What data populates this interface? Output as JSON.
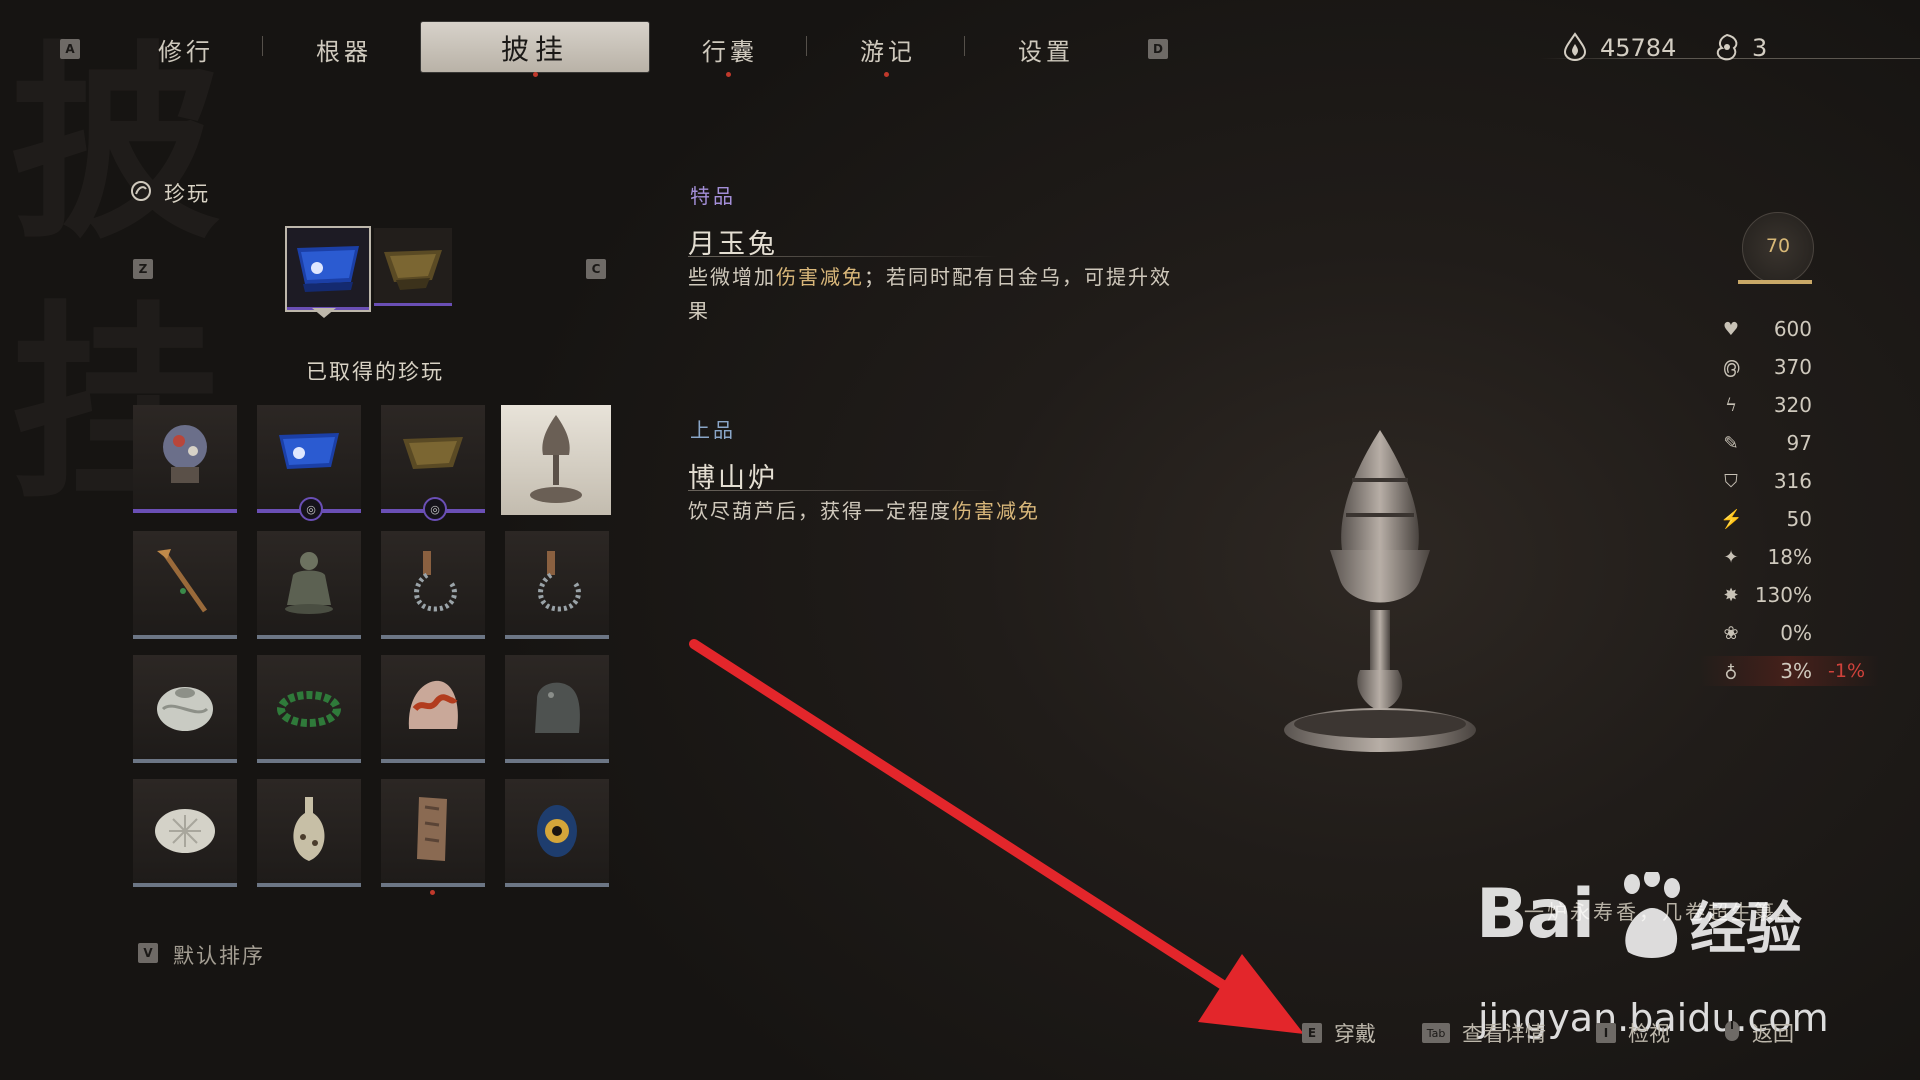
{
  "nav": {
    "left_key": "A",
    "right_key": "D",
    "tabs": [
      {
        "label": "修行"
      },
      {
        "label": "根器"
      },
      {
        "label": "披挂"
      },
      {
        "label": "行囊"
      },
      {
        "label": "游记"
      },
      {
        "label": "设置"
      }
    ]
  },
  "currency": {
    "will_value": "45784",
    "spirit_value": "3"
  },
  "background_chars": [
    "披",
    "挂"
  ],
  "left_panel": {
    "category_label": "珍玩",
    "prev_key": "Z",
    "next_key": "C",
    "acquired_title": "已取得的珍玩",
    "sort_key": "V",
    "sort_label": "默认排序"
  },
  "center": {
    "entries": [
      {
        "tier": "特品",
        "name": "月玉兔",
        "desc_pre": "些微增加",
        "desc_hl": "伤害减免",
        "desc_post": "；若同时配有日金乌，可提升效果"
      },
      {
        "tier": "上品",
        "name": "博山炉",
        "desc_pre": "饮尽葫芦后，获得一定程度",
        "desc_hl": "伤害减免",
        "desc_post": ""
      }
    ]
  },
  "stats": {
    "level": "70",
    "rows": [
      {
        "icon": "heart-icon",
        "value": "600",
        "diff": ""
      },
      {
        "icon": "mana-icon",
        "value": "370",
        "diff": ""
      },
      {
        "icon": "stamina-icon",
        "value": "320",
        "diff": ""
      },
      {
        "icon": "attack-icon",
        "value": "97",
        "diff": ""
      },
      {
        "icon": "defense-icon",
        "value": "316",
        "diff": ""
      },
      {
        "icon": "focus-icon",
        "value": "50",
        "diff": ""
      },
      {
        "icon": "crit-rate-icon",
        "value": "18%",
        "diff": ""
      },
      {
        "icon": "crit-damage-icon",
        "value": "130%",
        "diff": ""
      },
      {
        "icon": "lotus-icon",
        "value": "0%",
        "diff": ""
      },
      {
        "icon": "gourd-icon",
        "value": "3%",
        "diff": "-1%"
      }
    ]
  },
  "flavor_text": "一炉永寿香，几卷超生箓。",
  "bottom_bar": {
    "equip_key": "E",
    "equip_label": "穿戴",
    "details_key": "Tab",
    "details_label": "查看详情",
    "inspect_key": "I",
    "inspect_label": "检视",
    "back_label": "返回"
  },
  "overlay": {
    "baidu_brand": "Bai",
    "baidu_cn": "经验",
    "baidu_url": "jingyan.baidu.com"
  }
}
